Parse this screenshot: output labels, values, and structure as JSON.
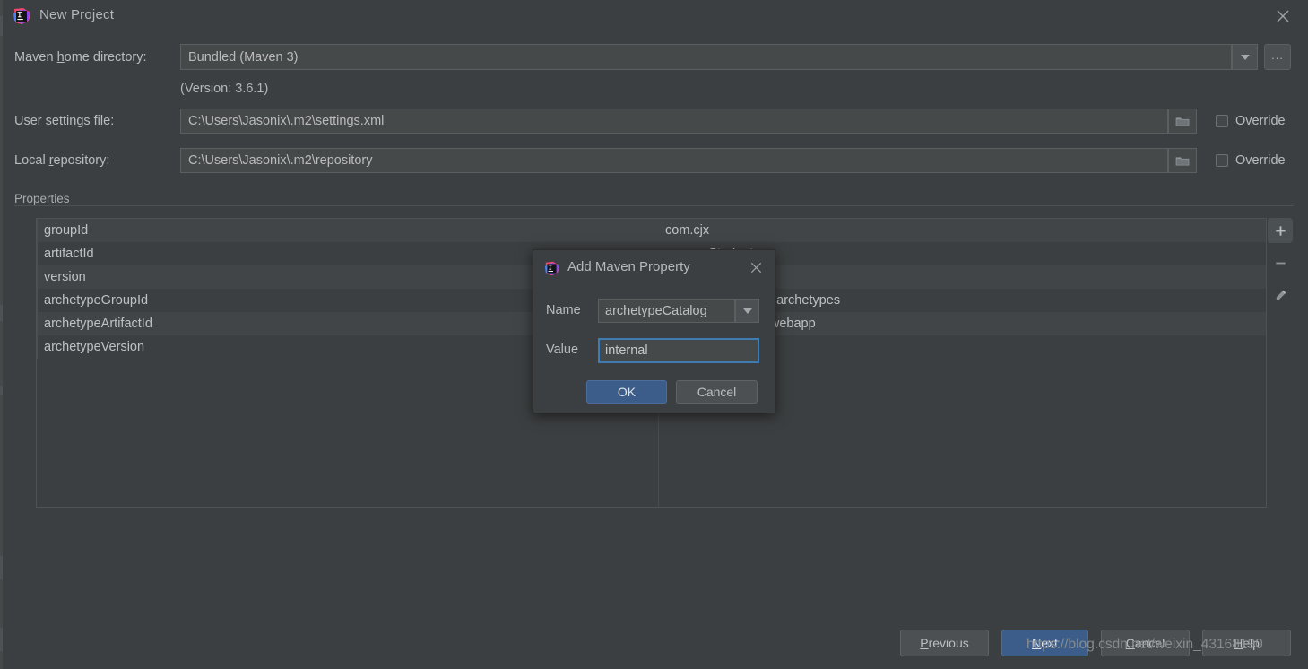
{
  "window": {
    "title": "New Project",
    "icon": "intellij-idea-icon",
    "close_icon": "close-icon"
  },
  "form": {
    "maven_home": {
      "label_pre": "Maven ",
      "label_accel": "h",
      "label_post": "ome directory:",
      "value": "Bundled (Maven 3)",
      "dropdown_icon": "chevron-down-icon",
      "browse_label": "...",
      "version_note": "(Version: 3.6.1)"
    },
    "user_settings": {
      "label_pre": "User ",
      "label_accel": "s",
      "label_post": "ettings file:",
      "value": "C:\\Users\\Jasonix\\.m2\\settings.xml",
      "browse_icon": "folder-icon",
      "override_label": "Override",
      "override_checked": false
    },
    "local_repository": {
      "label_pre": "Local ",
      "label_accel": "r",
      "label_post": "epository:",
      "value": "C:\\Users\\Jasonix\\.m2\\repository",
      "browse_icon": "folder-icon",
      "override_label": "Override",
      "override_checked": false
    }
  },
  "properties": {
    "group_label": "Properties",
    "rows": [
      {
        "key": "groupId",
        "value": "com.cjx"
      },
      {
        "key": "artifactId",
        "value": "maven-Student"
      },
      {
        "key": "version",
        "value": ""
      },
      {
        "key": "archetypeGroupId",
        "value": "org.apache.maven.archetypes"
      },
      {
        "key": "archetypeArtifactId",
        "value": "maven-archetype-webapp"
      },
      {
        "key": "archetypeVersion",
        "value": ""
      }
    ],
    "toolbar": [
      {
        "name": "add-property-button",
        "icon": "plus-icon",
        "active": true
      },
      {
        "name": "remove-property-button",
        "icon": "minus-icon",
        "active": false
      },
      {
        "name": "edit-property-button",
        "icon": "pencil-icon",
        "active": false
      }
    ]
  },
  "footer": {
    "previous": {
      "pre": "",
      "accel": "P",
      "post": "revious"
    },
    "next": {
      "pre": "",
      "accel": "N",
      "post": "ext"
    },
    "cancel": {
      "pre": "",
      "accel": "C",
      "post": "ancel"
    },
    "help": {
      "pre": "",
      "accel": "H",
      "post": "elp"
    }
  },
  "modal": {
    "title": "Add Maven Property",
    "icon": "intellij-idea-icon",
    "close_icon": "close-icon",
    "name_label": "Name",
    "name_value": "archetypeCatalog",
    "name_dropdown_icon": "chevron-down-icon",
    "value_label": "Value",
    "value_value": "internal",
    "ok_label": "OK",
    "cancel_label": "Cancel"
  },
  "watermark": "https://blog.csdn.net/weixin_43168190",
  "colors": {
    "background": "#3c3f41",
    "field_bg": "#45494a",
    "accent_blue": "#3c5d8a",
    "focus_blue": "#3f7cb4",
    "text": "#bbbbbb"
  }
}
